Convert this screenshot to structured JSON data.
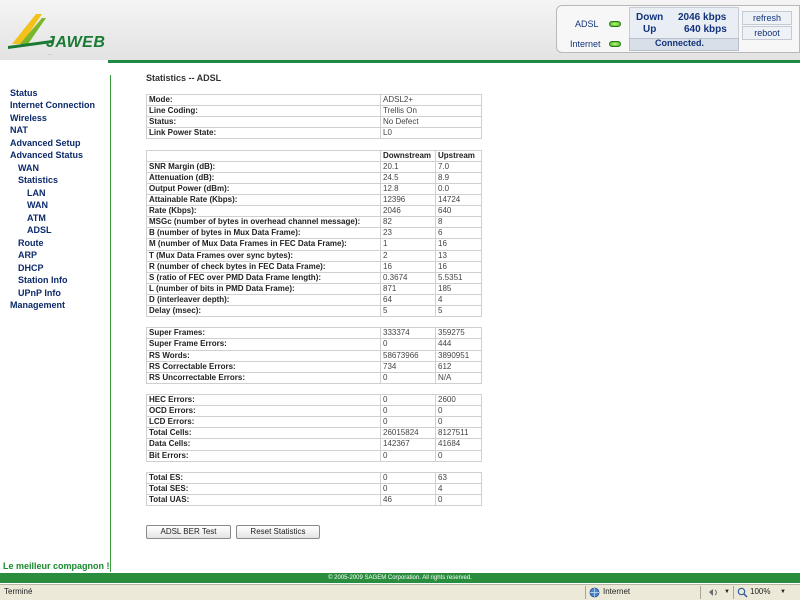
{
  "brand": {
    "name": "JAWEB",
    "tagline": "...",
    "slogan": "Le meilleur compagnon !"
  },
  "status_panel": {
    "adsl_label": "ADSL",
    "internet_label": "Internet",
    "down_label": "Down",
    "up_label": "Up",
    "down_rate": "2046 kbps",
    "up_rate": "640 kbps",
    "connection": "Connected.",
    "refresh": "refresh",
    "reboot": "reboot",
    "led_color": "#36a21c"
  },
  "nav": [
    {
      "label": "Status",
      "level": 0
    },
    {
      "label": "Internet Connection",
      "level": 0
    },
    {
      "label": "Wireless",
      "level": 0
    },
    {
      "label": "NAT",
      "level": 0
    },
    {
      "label": "Advanced Setup",
      "level": 0
    },
    {
      "label": "Advanced Status",
      "level": 0
    },
    {
      "label": "WAN",
      "level": 1
    },
    {
      "label": "Statistics",
      "level": 1
    },
    {
      "label": "LAN",
      "level": 2
    },
    {
      "label": "WAN",
      "level": 2
    },
    {
      "label": "ATM",
      "level": 2
    },
    {
      "label": "ADSL",
      "level": 2
    },
    {
      "label": "Route",
      "level": 1
    },
    {
      "label": "ARP",
      "level": 1
    },
    {
      "label": "DHCP",
      "level": 1
    },
    {
      "label": "Station Info",
      "level": 1
    },
    {
      "label": "UPnP Info",
      "level": 1
    },
    {
      "label": "Management",
      "level": 0
    }
  ],
  "page": {
    "title": "Statistics -- ADSL"
  },
  "table": {
    "header": {
      "downstream": "Downstream",
      "upstream": "Upstream"
    },
    "rows": [
      {
        "label": "Mode:",
        "single": "ADSL2+"
      },
      {
        "label": "Line Coding:",
        "single": "Trellis On"
      },
      {
        "label": "Status:",
        "single": "No Defect"
      },
      {
        "label": "Link Power State:",
        "single": "L0"
      },
      {
        "gap": true
      },
      {
        "header": true
      },
      {
        "label": "SNR Margin (dB):",
        "down": "20.1",
        "up": "7.0"
      },
      {
        "label": "Attenuation (dB):",
        "down": "24.5",
        "up": "8.9"
      },
      {
        "label": "Output Power (dBm):",
        "down": "12.8",
        "up": "0.0"
      },
      {
        "label": "Attainable Rate (Kbps):",
        "down": "12396",
        "up": "14724"
      },
      {
        "label": "Rate (Kbps):",
        "down": "2046",
        "up": "640"
      },
      {
        "label": "MSGc (number of bytes in overhead channel message):",
        "down": "82",
        "up": "8"
      },
      {
        "label": "B (number of bytes in Mux Data Frame):",
        "down": "23",
        "up": "6"
      },
      {
        "label": "M (number of Mux Data Frames in FEC Data Frame):",
        "down": "1",
        "up": "16"
      },
      {
        "label": "T (Mux Data Frames over sync bytes):",
        "down": "2",
        "up": "13"
      },
      {
        "label": "R (number of check bytes in FEC Data Frame):",
        "down": "16",
        "up": "16"
      },
      {
        "label": "S (ratio of FEC over PMD Data Frame length):",
        "down": "0.3674",
        "up": "5.5351"
      },
      {
        "label": "L (number of bits in PMD Data Frame):",
        "down": "871",
        "up": "185"
      },
      {
        "label": "D (interleaver depth):",
        "down": "64",
        "up": "4"
      },
      {
        "label": "Delay (msec):",
        "down": "5",
        "up": "5"
      },
      {
        "gap": true
      },
      {
        "label": "Super Frames:",
        "down": "333374",
        "up": "359275"
      },
      {
        "label": "Super Frame Errors:",
        "down": "0",
        "up": "444"
      },
      {
        "label": "RS Words:",
        "down": "58673966",
        "up": "3890951"
      },
      {
        "label": "RS Correctable Errors:",
        "down": "734",
        "up": "612"
      },
      {
        "label": "RS Uncorrectable Errors:",
        "down": "0",
        "up": "N/A"
      },
      {
        "gap": true
      },
      {
        "label": "HEC Errors:",
        "down": "0",
        "up": "2600"
      },
      {
        "label": "OCD Errors:",
        "down": "0",
        "up": "0"
      },
      {
        "label": "LCD Errors:",
        "down": "0",
        "up": "0"
      },
      {
        "label": "Total Cells:",
        "down": "26015824",
        "up": "8127511"
      },
      {
        "label": "Data Cells:",
        "down": "142367",
        "up": "41684"
      },
      {
        "label": "Bit Errors:",
        "down": "0",
        "up": "0"
      },
      {
        "gap": true
      },
      {
        "label": "Total ES:",
        "down": "0",
        "up": "63"
      },
      {
        "label": "Total SES:",
        "down": "0",
        "up": "4"
      },
      {
        "label": "Total UAS:",
        "down": "46",
        "up": "0"
      }
    ]
  },
  "buttons": {
    "ber_test": "ADSL BER Test",
    "reset": "Reset Statistics"
  },
  "footer": {
    "copyright": "© 2005-2009 SAGEM Corporation. All rights reserved."
  },
  "browser_status": {
    "left": "Terminé",
    "zone": "Internet",
    "zoom": "100%"
  },
  "colors": {
    "accent_green": "#2a8d3e",
    "nav_blue": "#0d2a6b"
  }
}
